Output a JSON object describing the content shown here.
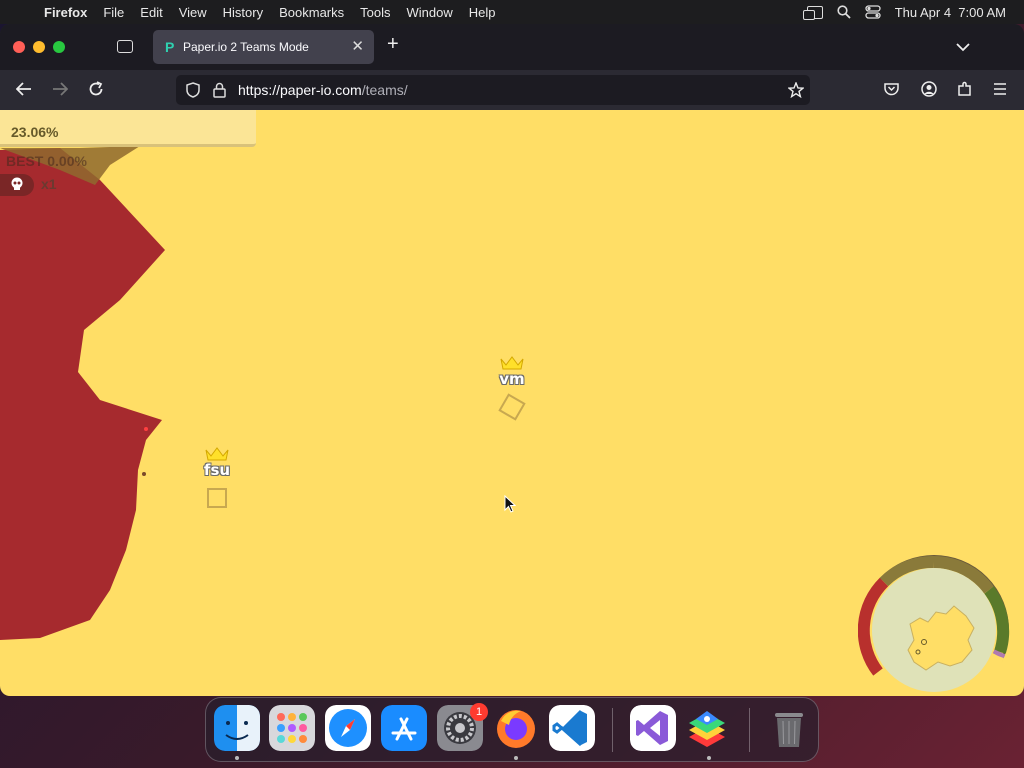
{
  "menubar": {
    "apple": "",
    "app_name": "Firefox",
    "menus": [
      "File",
      "Edit",
      "View",
      "History",
      "Bookmarks",
      "Tools",
      "Window",
      "Help"
    ],
    "datetime": "Thu Apr 4  7:00 AM"
  },
  "browser": {
    "tab_title": "Paper.io 2 Teams Mode",
    "tab_favicon": "P",
    "url_host": "https://paper-io.com",
    "url_path": "/teams/"
  },
  "game": {
    "territory_percent": "23.06%",
    "best": "BEST 0.00%",
    "kills": "x1",
    "players": [
      {
        "name": "fsu",
        "icon": "crown-icon"
      },
      {
        "name": "vm",
        "icon": "crown-icon"
      }
    ],
    "colors": {
      "team_territory": "#ffde66",
      "enemy_territory": "#a62a2e",
      "minimap_red": "#b8302d",
      "minimap_green": "#5a7a2a",
      "minimap_olive": "#8a7a3a"
    }
  },
  "dock": {
    "apps": [
      "finder-icon",
      "launchpad-icon",
      "safari-icon",
      "app-store-icon",
      "system-settings-icon",
      "firefox-icon",
      "vscode-icon",
      "visual-studio-icon",
      "bluestacks-icon",
      "trash-icon"
    ],
    "settings_badge": "1"
  }
}
